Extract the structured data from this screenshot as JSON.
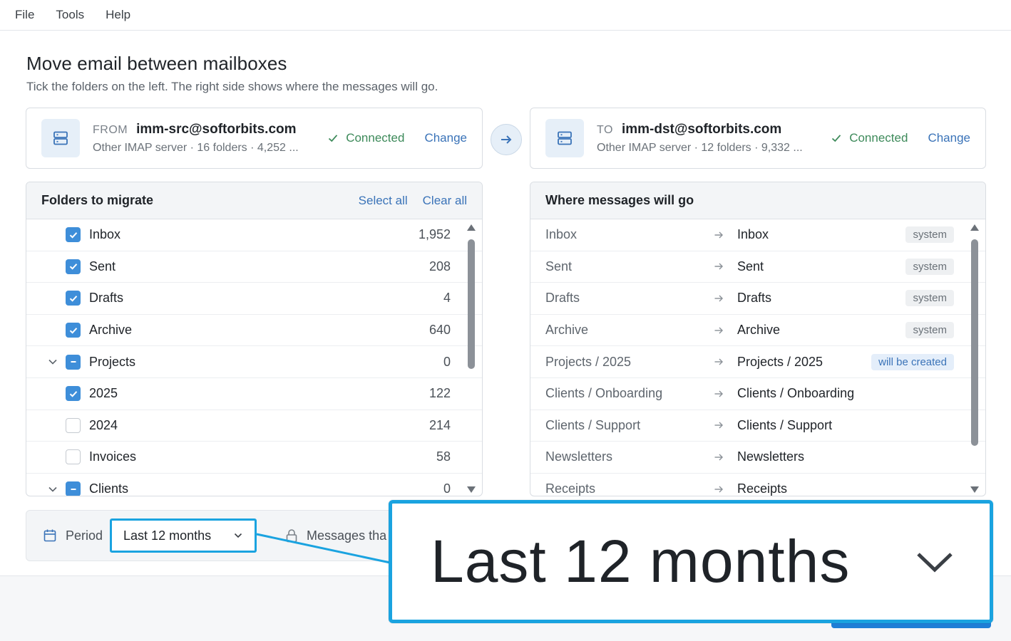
{
  "menu": {
    "file": "File",
    "tools": "Tools",
    "help": "Help"
  },
  "page": {
    "title": "Move email between mailboxes",
    "subtitle": "Tick the folders on the left. The right side shows where the messages will go."
  },
  "source": {
    "direction": "FROM",
    "email": "imm-src@softorbits.com",
    "meta": "Other IMAP server · 16 folders · 4,252 ...",
    "status": "Connected",
    "change": "Change"
  },
  "destination": {
    "direction": "TO",
    "email": "imm-dst@softorbits.com",
    "meta": "Other IMAP server · 12 folders · 9,332 ...",
    "status": "Connected",
    "change": "Change"
  },
  "folders_panel": {
    "title": "Folders to migrate",
    "select_all": "Select all",
    "clear_all": "Clear all",
    "rows": [
      {
        "name": "Inbox",
        "count": "1,952",
        "state": "checked",
        "indent": 1,
        "expander": false
      },
      {
        "name": "Sent",
        "count": "208",
        "state": "checked",
        "indent": 1,
        "expander": false
      },
      {
        "name": "Drafts",
        "count": "4",
        "state": "checked",
        "indent": 1,
        "expander": false
      },
      {
        "name": "Archive",
        "count": "640",
        "state": "checked",
        "indent": 1,
        "expander": false
      },
      {
        "name": "Projects",
        "count": "0",
        "state": "partial",
        "indent": 1,
        "expander": true
      },
      {
        "name": "2025",
        "count": "122",
        "state": "checked",
        "indent": 1,
        "expander": false
      },
      {
        "name": "2024",
        "count": "214",
        "state": "empty",
        "indent": 1,
        "expander": false
      },
      {
        "name": "Invoices",
        "count": "58",
        "state": "empty",
        "indent": 1,
        "expander": false
      },
      {
        "name": "Clients",
        "count": "0",
        "state": "partial",
        "indent": 1,
        "expander": true
      }
    ]
  },
  "mapping_panel": {
    "title": "Where messages will go",
    "rows": [
      {
        "source": "Inbox",
        "destination": "Inbox",
        "badge": "system",
        "badge_type": "system"
      },
      {
        "source": "Sent",
        "destination": "Sent",
        "badge": "system",
        "badge_type": "system"
      },
      {
        "source": "Drafts",
        "destination": "Drafts",
        "badge": "system",
        "badge_type": "system"
      },
      {
        "source": "Archive",
        "destination": "Archive",
        "badge": "system",
        "badge_type": "system"
      },
      {
        "source": "Projects / 2025",
        "destination": "Projects / 2025",
        "badge": "will be created",
        "badge_type": "new"
      },
      {
        "source": "Clients / Onboarding",
        "destination": "Clients / Onboarding",
        "badge": "",
        "badge_type": ""
      },
      {
        "source": "Clients / Support",
        "destination": "Clients / Support",
        "badge": "",
        "badge_type": ""
      },
      {
        "source": "Newsletters",
        "destination": "Newsletters",
        "badge": "",
        "badge_type": ""
      },
      {
        "source": "Receipts",
        "destination": "Receipts",
        "badge": "",
        "badge_type": ""
      }
    ]
  },
  "period": {
    "label": "Period",
    "value": "Last 12 months",
    "lock_text": "Messages tha"
  },
  "zoom_callout": {
    "value": "Last 12 months"
  },
  "colors": {
    "accent": "#3e8ed9",
    "link": "#3a73b8",
    "success": "#3d8a5a",
    "highlight": "#1aa3e0"
  }
}
